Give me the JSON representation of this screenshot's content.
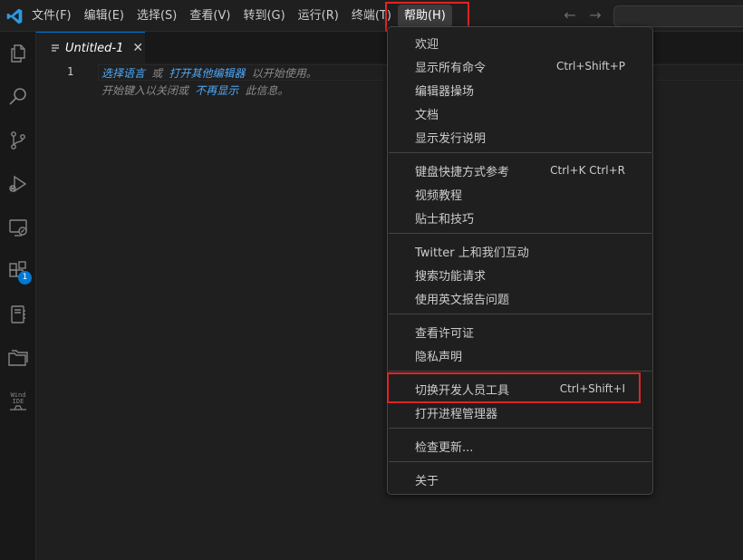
{
  "menubar": {
    "items": [
      {
        "label": "文件(F)"
      },
      {
        "label": "编辑(E)"
      },
      {
        "label": "选择(S)"
      },
      {
        "label": "查看(V)"
      },
      {
        "label": "转到(G)"
      },
      {
        "label": "运行(R)"
      },
      {
        "label": "终端(T)"
      },
      {
        "label": "帮助(H)",
        "active": true
      }
    ]
  },
  "navigation": {
    "back_icon": "arrow-left-icon",
    "forward_icon": "arrow-right-icon"
  },
  "activitybar": {
    "extensions_badge": "1",
    "wind_ide_label_top": "Wind",
    "wind_ide_label_bottom": "IDE"
  },
  "tab": {
    "label": "Untitled-1",
    "close_symbol": "✕"
  },
  "editor": {
    "line_number": "1",
    "hint_line1": {
      "link1": "选择语言",
      "sep": " 或 ",
      "link2": "打开其他编辑器",
      "suffix": " 以开始使用。"
    },
    "hint_line2": {
      "prefix": "开始键入以关闭或 ",
      "link": "不再显示",
      "suffix": " 此信息。"
    }
  },
  "help_menu": {
    "groups": [
      [
        {
          "label": "欢迎",
          "shortcut": ""
        },
        {
          "label": "显示所有命令",
          "shortcut": "Ctrl+Shift+P"
        },
        {
          "label": "编辑器操场",
          "shortcut": ""
        },
        {
          "label": "文档",
          "shortcut": ""
        },
        {
          "label": "显示发行说明",
          "shortcut": ""
        }
      ],
      [
        {
          "label": "键盘快捷方式参考",
          "shortcut": "Ctrl+K Ctrl+R"
        },
        {
          "label": "视频教程",
          "shortcut": ""
        },
        {
          "label": "贴士和技巧",
          "shortcut": ""
        }
      ],
      [
        {
          "label": "Twitter 上和我们互动",
          "shortcut": ""
        },
        {
          "label": "搜索功能请求",
          "shortcut": ""
        },
        {
          "label": "使用英文报告问题",
          "shortcut": ""
        }
      ],
      [
        {
          "label": "查看许可证",
          "shortcut": ""
        },
        {
          "label": "隐私声明",
          "shortcut": ""
        }
      ],
      [
        {
          "label": "切换开发人员工具",
          "shortcut": "Ctrl+Shift+I",
          "highlighted": true
        },
        {
          "label": "打开进程管理器",
          "shortcut": ""
        }
      ],
      [
        {
          "label": "检查更新...",
          "shortcut": ""
        }
      ],
      [
        {
          "label": "关于",
          "shortcut": ""
        }
      ]
    ]
  },
  "colors": {
    "accent": "#0078d4",
    "highlight_box": "#e02424",
    "link": "#4daafc"
  }
}
